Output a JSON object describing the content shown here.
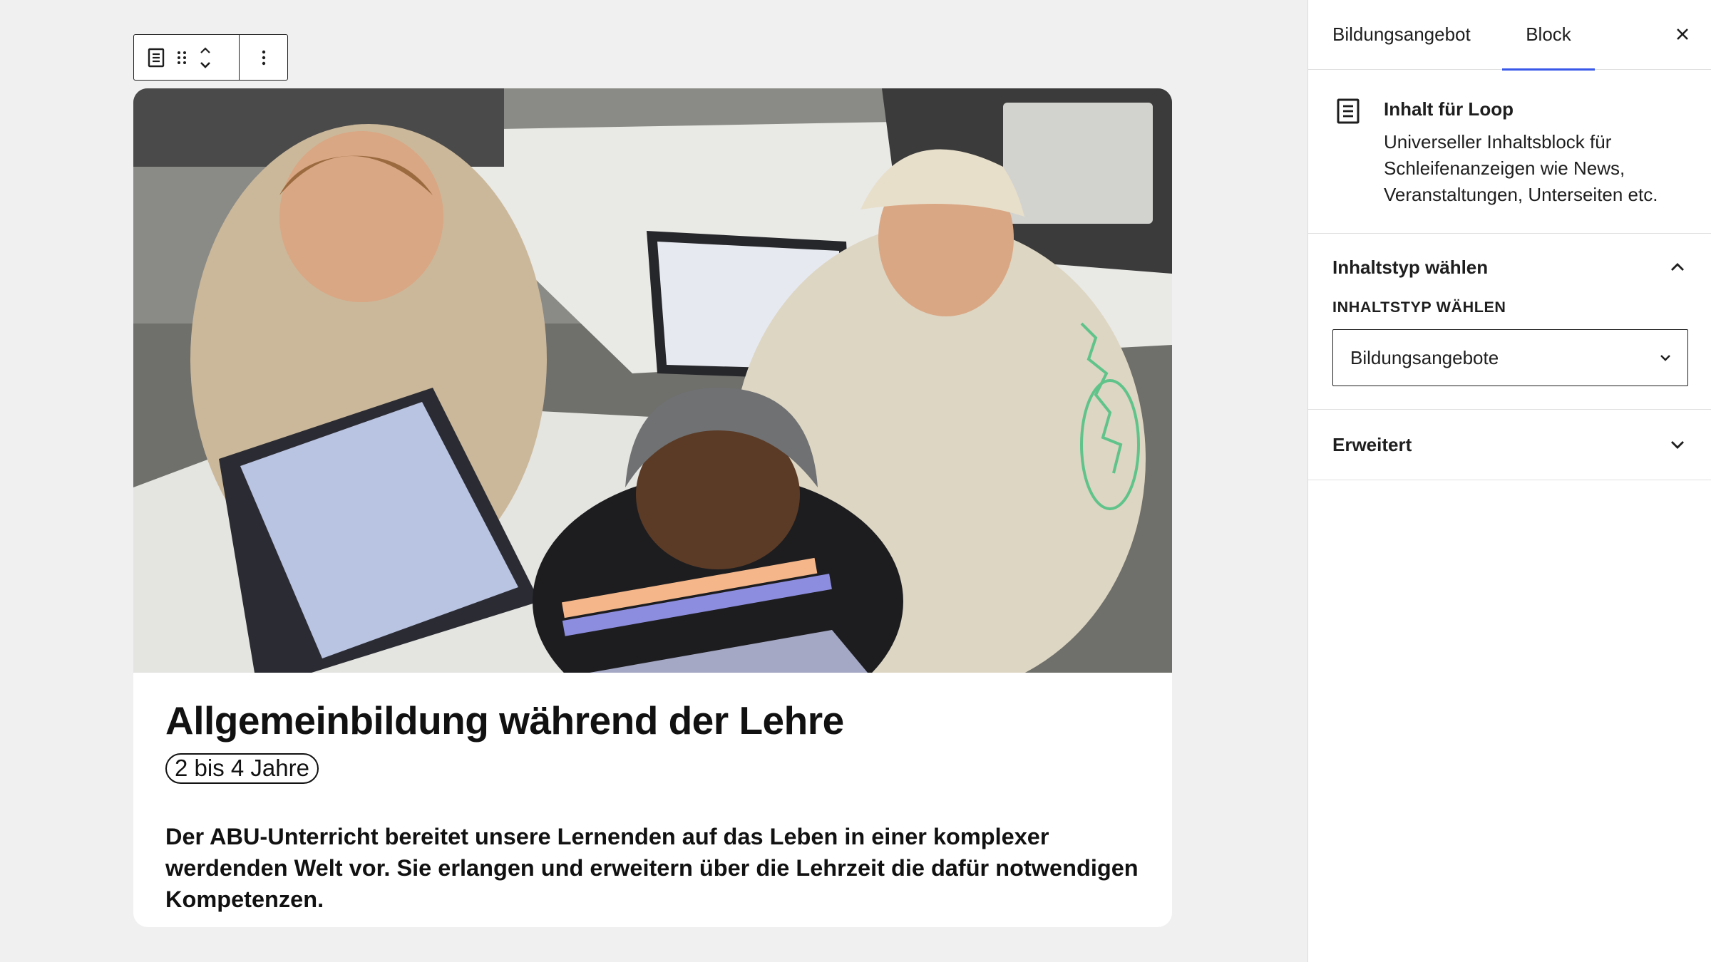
{
  "editor": {
    "toolbar": {
      "block_type_icon": "list-document-icon",
      "drag_icon": "drag-handle-icon",
      "move_up_icon": "chevron-up-icon",
      "move_down_icon": "chevron-down-icon",
      "options_icon": "more-vertical-icon"
    },
    "card": {
      "image_description": "classroom-students-laptops-photo",
      "title": "Allgemeinbildung während der Lehre",
      "badge": "2 bis 4 Jahre",
      "text": "Der ABU-Unterricht bereitet unsere Lernenden auf das Leben in einer komplexer werdenden Welt vor. Sie erlangen und erweitern über die Lehrzeit die dafür notwendigen Kompetenzen."
    }
  },
  "sidebar": {
    "tabs": [
      {
        "label": "Bildungsangebot",
        "active": false
      },
      {
        "label": "Block",
        "active": true
      }
    ],
    "close_icon": "close-icon",
    "block_card": {
      "icon": "list-document-icon",
      "title": "Inhalt für Loop",
      "description": "Universeller Inhaltsblock für Schleifenanzeigen wie News, Veranstaltungen, Unterseiten etc."
    },
    "panels": [
      {
        "title": "Inhaltstyp wählen",
        "expanded": true,
        "field_label": "Inhaltstyp wählen",
        "select_value": "Bildungsangebote"
      },
      {
        "title": "Erweitert",
        "expanded": false
      }
    ]
  },
  "colors": {
    "accent": "#3858e9",
    "canvas_bg": "#f0f0f0",
    "text": "#1e1e1e"
  }
}
